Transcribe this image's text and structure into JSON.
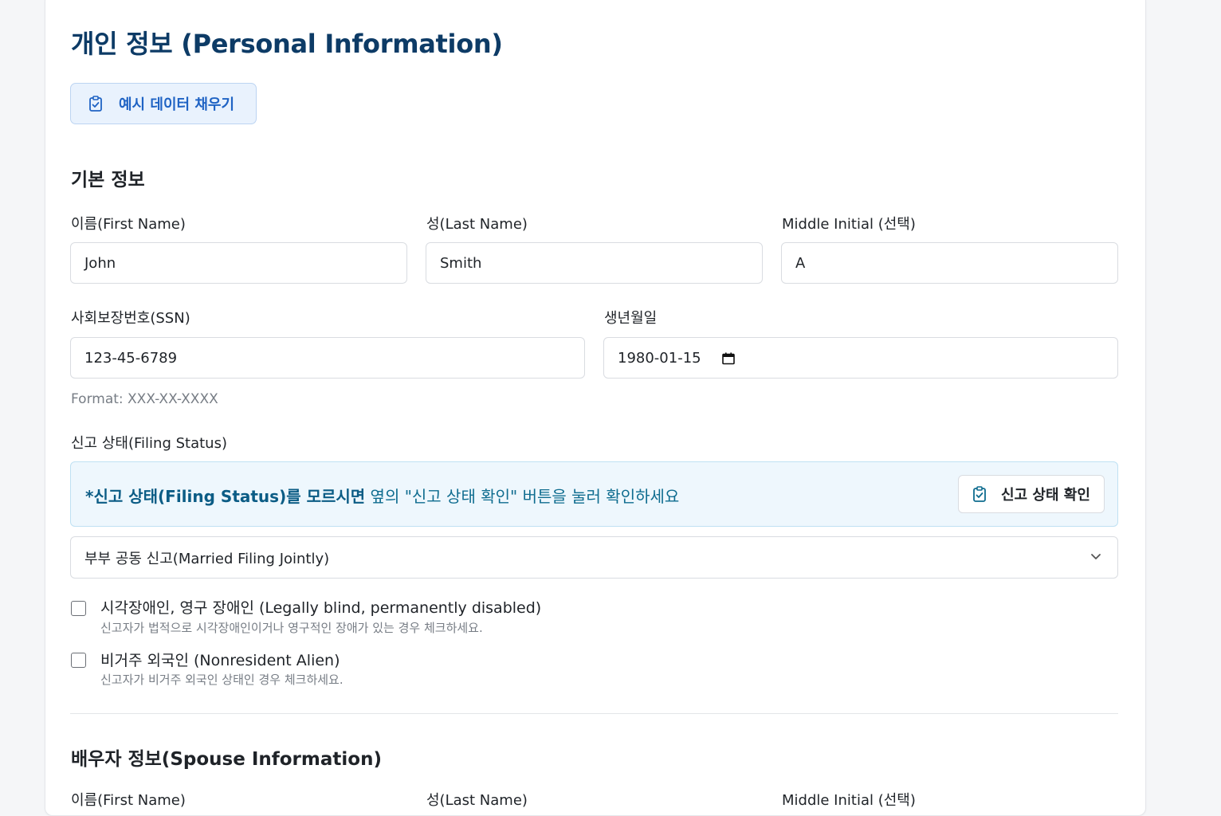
{
  "page": {
    "title": "개인 정보 (Personal Information)",
    "fill_example_label": "예시 데이터 채우기"
  },
  "basic": {
    "section_title": "기본 정보",
    "first_name": {
      "label": "이름(First Name)",
      "value": "John"
    },
    "last_name": {
      "label": "성(Last Name)",
      "value": "Smith"
    },
    "middle_initial": {
      "label": "Middle Initial (선택)",
      "value": "A"
    },
    "ssn": {
      "label": "사회보장번호(SSN)",
      "value": "123-45-6789",
      "hint": "Format: XXX-XX-XXXX"
    },
    "dob": {
      "label": "생년월일",
      "value": "1980-01-15"
    }
  },
  "filing": {
    "label": "신고 상태(Filing Status)",
    "notice_strong": "*신고 상태(Filing Status)를 모르시면",
    "notice_rest": " 옆의 \"신고 상태 확인\" 버튼을 눌러 확인하세요",
    "check_button": "신고 상태 확인",
    "selected": "부부 공동 신고(Married Filing Jointly)"
  },
  "checkboxes": [
    {
      "title": "시각장애인, 영구 장애인 (Legally blind, permanently disabled)",
      "sub": "신고자가 법적으로 시각장애인이거나 영구적인 장애가 있는 경우 체크하세요.",
      "checked": false
    },
    {
      "title": "비거주 외국인 (Nonresident Alien)",
      "sub": "신고자가 비거주 외국인 상태인 경우 체크하세요.",
      "checked": false
    }
  ],
  "spouse": {
    "section_title": "배우자 정보(Spouse Information)",
    "first_name_label": "이름(First Name)",
    "last_name_label": "성(Last Name)",
    "middle_initial_label": "Middle Initial (선택)"
  },
  "colors": {
    "title": "#0d3b66",
    "accent": "#1f63c4",
    "notice_bg": "#eef7fd"
  },
  "icons": {
    "fill_button": "clipboard-check-icon",
    "notice_button": "clipboard-check-icon",
    "select": "chevron-down-icon",
    "date": "calendar-icon"
  }
}
